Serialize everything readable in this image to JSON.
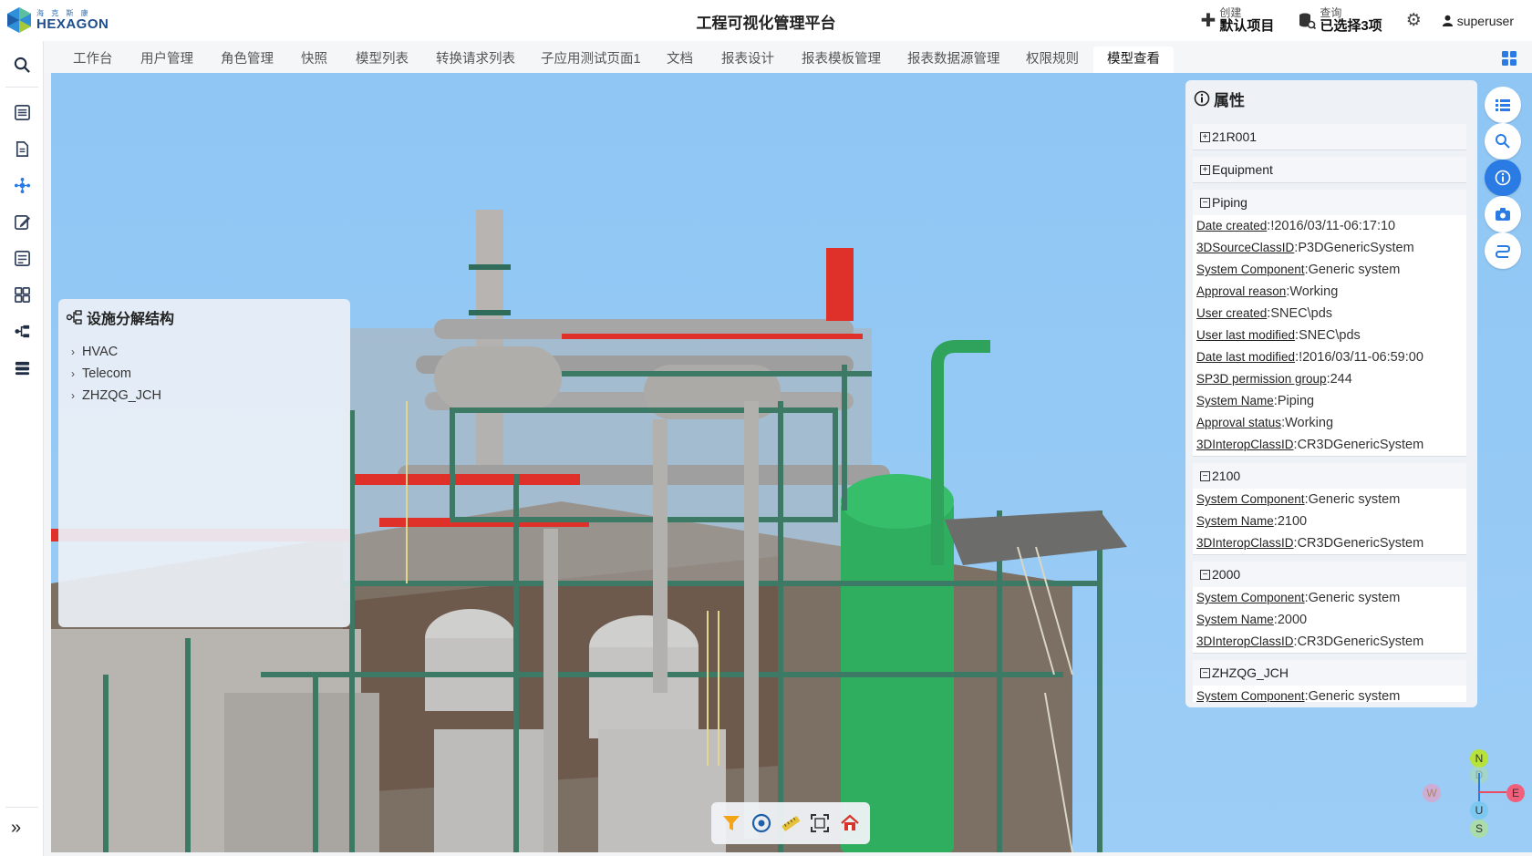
{
  "header": {
    "logo_cn": "海 克 斯 康",
    "logo_en": "HEXAGON",
    "title": "工程可视化管理平台",
    "create": {
      "small": "创建",
      "big": "默认项目"
    },
    "query": {
      "small": "查询",
      "big": "已选择3项"
    },
    "username": "superuser"
  },
  "tabs": [
    {
      "label": "工作台"
    },
    {
      "label": "用户管理"
    },
    {
      "label": "角色管理"
    },
    {
      "label": "快照"
    },
    {
      "label": "模型列表"
    },
    {
      "label": "转换请求列表"
    },
    {
      "label": "子应用测试页面1"
    },
    {
      "label": "文档"
    },
    {
      "label": "报表设计"
    },
    {
      "label": "报表模板管理"
    },
    {
      "label": "报表数据源管理"
    },
    {
      "label": "权限规则"
    },
    {
      "label": "模型查看"
    }
  ],
  "tree_panel": {
    "title": "设施分解结构",
    "items": [
      "HVAC",
      "Telecom",
      "ZHZQG_JCH"
    ]
  },
  "properties": {
    "title": "属性",
    "groups": [
      {
        "name": "21R001",
        "expanded": false,
        "rows": []
      },
      {
        "name": "Equipment",
        "expanded": false,
        "rows": []
      },
      {
        "name": "Piping",
        "expanded": true,
        "rows": [
          {
            "k": "Date created",
            "v": "!2016/03/11-06:17:10"
          },
          {
            "k": "3DSourceClassID",
            "v": "P3DGenericSystem"
          },
          {
            "k": "System Component",
            "v": "Generic system"
          },
          {
            "k": "Approval reason",
            "v": "Working"
          },
          {
            "k": "User created",
            "v": "SNEC\\pds"
          },
          {
            "k": "User last modified",
            "v": "SNEC\\pds"
          },
          {
            "k": "Date last modified",
            "v": "!2016/03/11-06:59:00"
          },
          {
            "k": "SP3D permission group",
            "v": "244"
          },
          {
            "k": "System Name",
            "v": "Piping"
          },
          {
            "k": "Approval status",
            "v": "Working"
          },
          {
            "k": "3DInteropClassID",
            "v": "CR3DGenericSystem"
          }
        ]
      },
      {
        "name": "2100",
        "expanded": true,
        "rows": [
          {
            "k": "System Component",
            "v": "Generic system"
          },
          {
            "k": "System Name",
            "v": "2100"
          },
          {
            "k": "3DInteropClassID",
            "v": "CR3DGenericSystem"
          }
        ]
      },
      {
        "name": "2000",
        "expanded": true,
        "rows": [
          {
            "k": "System Component",
            "v": "Generic system"
          },
          {
            "k": "System Name",
            "v": "2000"
          },
          {
            "k": "3DInteropClassID",
            "v": "CR3DGenericSystem"
          }
        ]
      },
      {
        "name": "ZHZQG_JCH",
        "expanded": true,
        "rows": [
          {
            "k": "System Component",
            "v": "Generic system"
          }
        ]
      }
    ]
  },
  "compass": {
    "n": "N",
    "d": "D",
    "w": "W",
    "e": "E",
    "u": "U",
    "s": "S"
  },
  "colors": {
    "accent": "#2a7be4",
    "sky": "#9ccdf6",
    "steel_green": "#3d7a66",
    "pipe_red": "#e0302a",
    "vessel_green": "#2fae60",
    "pipe_gray": "#a9a9a9"
  }
}
